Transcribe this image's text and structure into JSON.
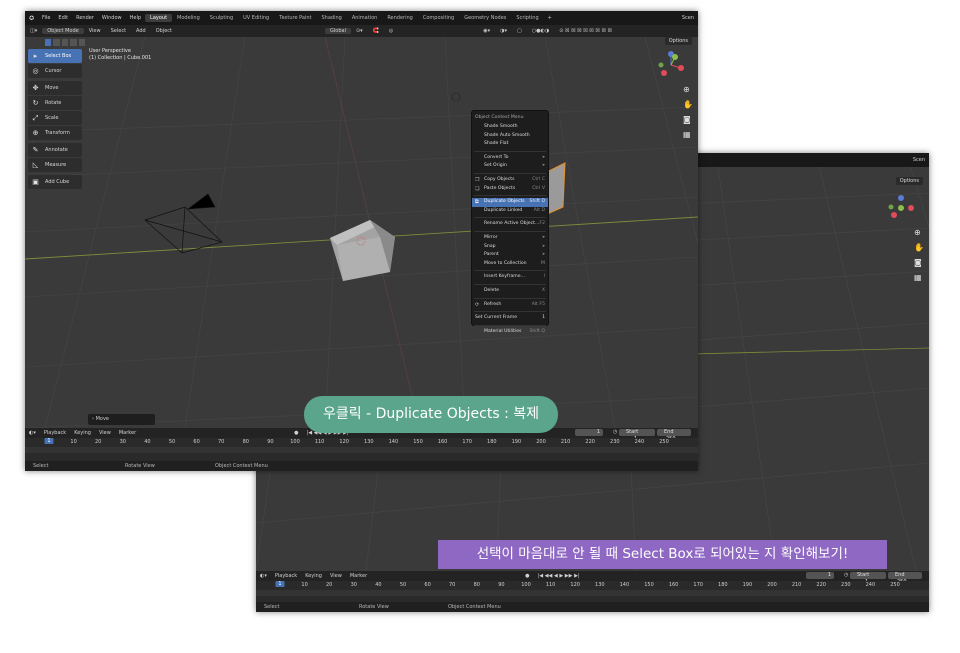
{
  "colors": {
    "accent_blue": "#4772b3",
    "viewport_bg": "#3a3a3a",
    "caption1_bg": "#5aa58b",
    "caption2_bg": "#8e68c2",
    "selection_orange": "#e8912d"
  },
  "topbar": {
    "menus": [
      "File",
      "Edit",
      "Render",
      "Window",
      "Help"
    ],
    "workspaces": [
      "Layout",
      "Modeling",
      "Sculpting",
      "UV Editing",
      "Texture Paint",
      "Shading",
      "Animation",
      "Rendering",
      "Compositing",
      "Geometry Nodes",
      "Scripting"
    ],
    "active_workspace": "Layout",
    "add_tab": "+",
    "scene": "Scen"
  },
  "header": {
    "mode": "Object Mode",
    "menus": [
      "View",
      "Select",
      "Add",
      "Object"
    ],
    "orientation": "Global",
    "options": "Options"
  },
  "viewport": {
    "perspective": "User Perspective",
    "collection": "(1) Collection | Cube.001"
  },
  "toolbar": {
    "tools": [
      {
        "label": "Select Box",
        "icon": "select-box-icon",
        "glyph": "▸",
        "active": true
      },
      {
        "label": "Cursor",
        "icon": "cursor-icon",
        "glyph": "◎",
        "active": false
      },
      {
        "label": "Move",
        "icon": "move-icon",
        "glyph": "✥",
        "active": false
      },
      {
        "label": "Rotate",
        "icon": "rotate-icon",
        "glyph": "↻",
        "active": false
      },
      {
        "label": "Scale",
        "icon": "scale-icon",
        "glyph": "⤢",
        "active": false
      },
      {
        "label": "Transform",
        "icon": "transform-icon",
        "glyph": "⊕",
        "active": false
      },
      {
        "label": "Annotate",
        "icon": "annotate-icon",
        "glyph": "✎",
        "active": false
      },
      {
        "label": "Measure",
        "icon": "measure-icon",
        "glyph": "◺",
        "active": false
      },
      {
        "label": "Add Cube",
        "icon": "add-cube-icon",
        "glyph": "▣",
        "active": false
      }
    ]
  },
  "context_menu": {
    "title": "Object Context Menu",
    "items": [
      {
        "label": "Shade Smooth",
        "shortcut": ""
      },
      {
        "label": "Shade Auto Smooth",
        "shortcut": ""
      },
      {
        "label": "Shade Flat",
        "shortcut": ""
      },
      {
        "sep": true
      },
      {
        "label": "Convert To",
        "shortcut": "▸"
      },
      {
        "label": "Set Origin",
        "shortcut": "▸"
      },
      {
        "sep": true
      },
      {
        "label": "Copy Objects",
        "shortcut": "Ctrl C",
        "icon": "❐"
      },
      {
        "label": "Paste Objects",
        "shortcut": "Ctrl V",
        "icon": "❏"
      },
      {
        "sep": true
      },
      {
        "label": "Duplicate Objects",
        "shortcut": "Shift D",
        "icon": "⧉",
        "highlight": true
      },
      {
        "label": "Duplicate Linked",
        "shortcut": "Alt D"
      },
      {
        "sep": true
      },
      {
        "label": "Rename Active Object...",
        "shortcut": "F2"
      },
      {
        "sep": true
      },
      {
        "label": "Mirror",
        "shortcut": "▸"
      },
      {
        "label": "Snap",
        "shortcut": "▸"
      },
      {
        "label": "Parent",
        "shortcut": "▸"
      },
      {
        "label": "Move to Collection",
        "shortcut": "M"
      },
      {
        "sep": true
      },
      {
        "label": "Insert Keyframe...",
        "shortcut": "I"
      },
      {
        "sep": true
      },
      {
        "label": "Delete",
        "shortcut": "X"
      },
      {
        "sep": true
      },
      {
        "label": "Refresh",
        "shortcut": "Alt F5",
        "icon": "⟳"
      },
      {
        "sep": true
      },
      {
        "label": "Set Current Frame",
        "shortcut": "1"
      },
      {
        "sep": true
      },
      {
        "label": "Material Utilities",
        "shortcut": "Shift Q"
      }
    ]
  },
  "redo_panel": "Move",
  "timeline": {
    "menus": [
      "Playback",
      "Keying",
      "View",
      "Marker"
    ],
    "current_frame": "1",
    "start_label": "Start",
    "start": "1",
    "end_label": "End",
    "end": "250",
    "ticks": [
      "1",
      "10",
      "20",
      "30",
      "40",
      "50",
      "60",
      "70",
      "80",
      "90",
      "100",
      "110",
      "120",
      "130",
      "140",
      "150",
      "160",
      "170",
      "180",
      "190",
      "200",
      "210",
      "220",
      "230",
      "240",
      "250"
    ]
  },
  "statusbar": {
    "select": "Select",
    "rotate": "Rotate View",
    "menu": "Object Context Menu"
  },
  "captions": {
    "first": "우클릭 - Duplicate Objects : 복제",
    "second": "선택이 마음대로 안 될 때 Select Box로 되어있는 지 확인해보기!"
  }
}
